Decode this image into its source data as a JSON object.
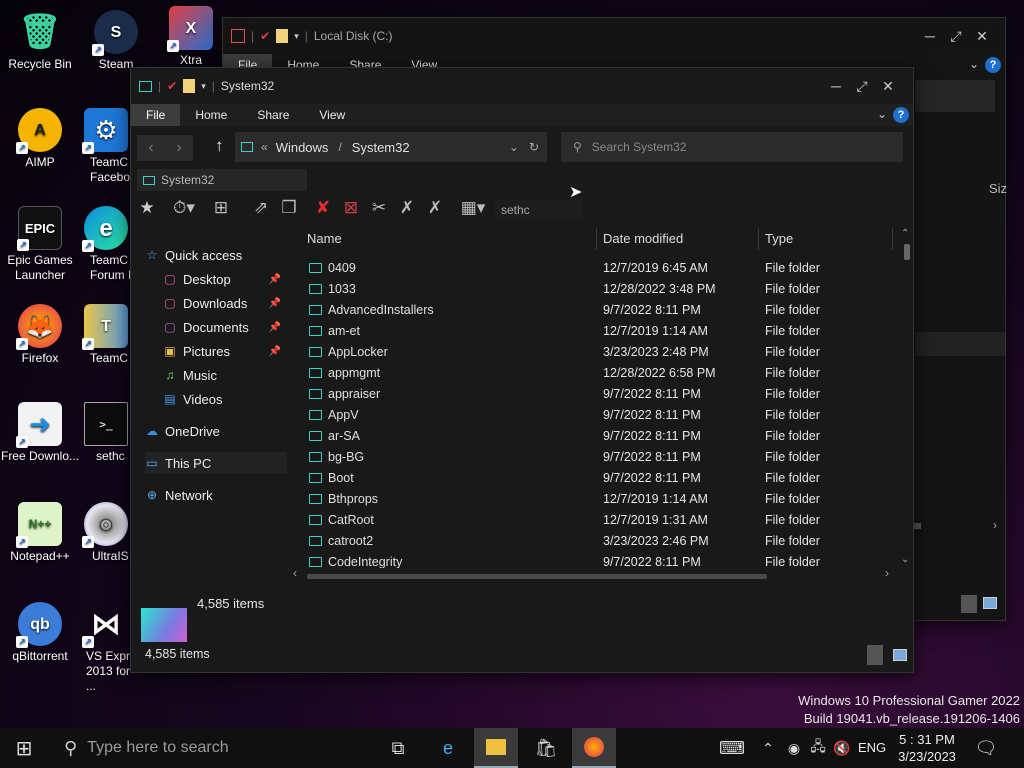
{
  "desktop": {
    "icons": [
      {
        "label": "Recycle Bin",
        "glyph": "🗑"
      },
      {
        "label": "Steam",
        "glyph": "S"
      },
      {
        "label": "Xtra",
        "glyph": "X"
      },
      {
        "label": "AIMP",
        "glyph": "A"
      },
      {
        "label": "TeamC Facebo",
        "glyph": "⚙"
      },
      {
        "label": "Epic Games Launcher",
        "glyph": "EPIC"
      },
      {
        "label": "TeamC Forum L",
        "glyph": "e"
      },
      {
        "label": "Firefox",
        "glyph": "🦊"
      },
      {
        "label": "TeamC",
        "glyph": "T"
      },
      {
        "label": "Free Downlo...",
        "glyph": "➜"
      },
      {
        "label": "sethc",
        "glyph": ">_"
      },
      {
        "label": "Notepad++",
        "glyph": "N++"
      },
      {
        "label": "UltraIS",
        "glyph": "◎"
      },
      {
        "label": "qBittorrent",
        "glyph": "qb"
      },
      {
        "label": "VS Expr 2013 for ...",
        "glyph": "⋈"
      }
    ],
    "watermark_line1": "Windows 10 Professional Gamer 2022",
    "watermark_line2": "Build 19041.vb_release.191206-1406"
  },
  "back_window": {
    "title": "Local Disk (C:)",
    "tabs": [
      "File",
      "Home",
      "Share",
      "View"
    ],
    "col_size": "Siz"
  },
  "window": {
    "title": "System32",
    "tabs": [
      "File",
      "Home",
      "Share",
      "View"
    ],
    "address": {
      "prefix": "«",
      "seg1": "Windows",
      "sep": "/",
      "seg2": "System32"
    },
    "search_placeholder": "Search System32",
    "location_tab": "System32",
    "toolbar_filter": "sethc",
    "nav": {
      "quick_access": "Quick access",
      "items": [
        {
          "label": "Desktop",
          "pinned": true
        },
        {
          "label": "Downloads",
          "pinned": true
        },
        {
          "label": "Documents",
          "pinned": true
        },
        {
          "label": "Pictures",
          "pinned": true
        },
        {
          "label": "Music",
          "pinned": false
        },
        {
          "label": "Videos",
          "pinned": false
        }
      ],
      "onedrive": "OneDrive",
      "this_pc": "This PC",
      "network": "Network"
    },
    "columns": {
      "name": "Name",
      "date": "Date modified",
      "type": "Type"
    },
    "rows": [
      {
        "name": "0409",
        "date": "12/7/2019 6:45 AM",
        "type": "File folder"
      },
      {
        "name": "1033",
        "date": "12/28/2022 3:48 PM",
        "type": "File folder"
      },
      {
        "name": "AdvancedInstallers",
        "date": "9/7/2022 8:11 PM",
        "type": "File folder"
      },
      {
        "name": "am-et",
        "date": "12/7/2019 1:14 AM",
        "type": "File folder"
      },
      {
        "name": "AppLocker",
        "date": "3/23/2023 2:48 PM",
        "type": "File folder"
      },
      {
        "name": "appmgmt",
        "date": "12/28/2022 6:58 PM",
        "type": "File folder"
      },
      {
        "name": "appraiser",
        "date": "9/7/2022 8:11 PM",
        "type": "File folder"
      },
      {
        "name": "AppV",
        "date": "9/7/2022 8:11 PM",
        "type": "File folder"
      },
      {
        "name": "ar-SA",
        "date": "9/7/2022 8:11 PM",
        "type": "File folder"
      },
      {
        "name": "bg-BG",
        "date": "9/7/2022 8:11 PM",
        "type": "File folder"
      },
      {
        "name": "Boot",
        "date": "9/7/2022 8:11 PM",
        "type": "File folder"
      },
      {
        "name": "Bthprops",
        "date": "12/7/2019 1:14 AM",
        "type": "File folder"
      },
      {
        "name": "CatRoot",
        "date": "12/7/2019 1:31 AM",
        "type": "File folder"
      },
      {
        "name": "catroot2",
        "date": "3/23/2023 2:46 PM",
        "type": "File folder"
      },
      {
        "name": "CodeIntegrity",
        "date": "9/7/2022 8:11 PM",
        "type": "File folder"
      }
    ],
    "item_count_top": "4,585 items",
    "item_count_bottom": "4,585 items"
  },
  "taskbar": {
    "search_placeholder": "Type here to search",
    "lang": "ENG",
    "time": "5 : 31 PM",
    "date": "3/23/2023"
  },
  "colors": {
    "folder": "#3fd0c9",
    "accent": "#1f6fd0"
  }
}
